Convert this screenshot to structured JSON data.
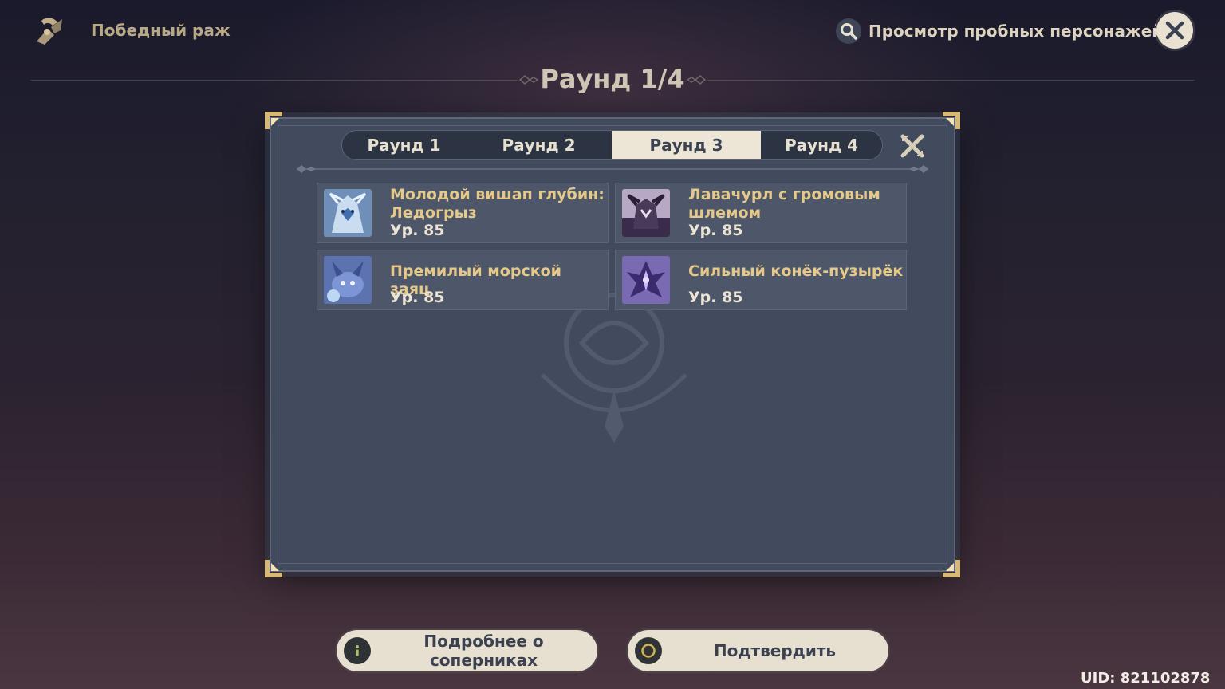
{
  "header": {
    "event_title": "Победный раж",
    "trial_link_label": "Просмотр пробных персонажей",
    "page_title": "Раунд 1/4"
  },
  "tabs": [
    {
      "label": "Раунд 1",
      "active": false
    },
    {
      "label": "Раунд 2",
      "active": false
    },
    {
      "label": "Раунд 3",
      "active": true
    },
    {
      "label": "Раунд 4",
      "active": false
    }
  ],
  "enemies": [
    {
      "name": "Молодой вишап глубин: Ледогрыз",
      "level": "Ур. 85",
      "icon": "ice-vishap-portrait"
    },
    {
      "name": "Лавачурл с громовым шлемом",
      "level": "Ур. 85",
      "icon": "lawachurl-portrait"
    },
    {
      "name": "Премилый морской заяц",
      "level": "Ур. 85",
      "icon": "sea-hare-portrait"
    },
    {
      "name": "Сильный конёк-пузырёк",
      "level": "Ур. 85",
      "icon": "bubble-seahorse-portrait"
    }
  ],
  "buttons": {
    "details_label": "Подробнее о соперниках",
    "confirm_label": "Подтвердить"
  },
  "uid": "UID: 821102878",
  "colors": {
    "accent_gold": "#e4c98a",
    "panel_bg": "#414b5d",
    "active_tab": "#ede6d6",
    "button_bg": "#e7dfcf"
  }
}
